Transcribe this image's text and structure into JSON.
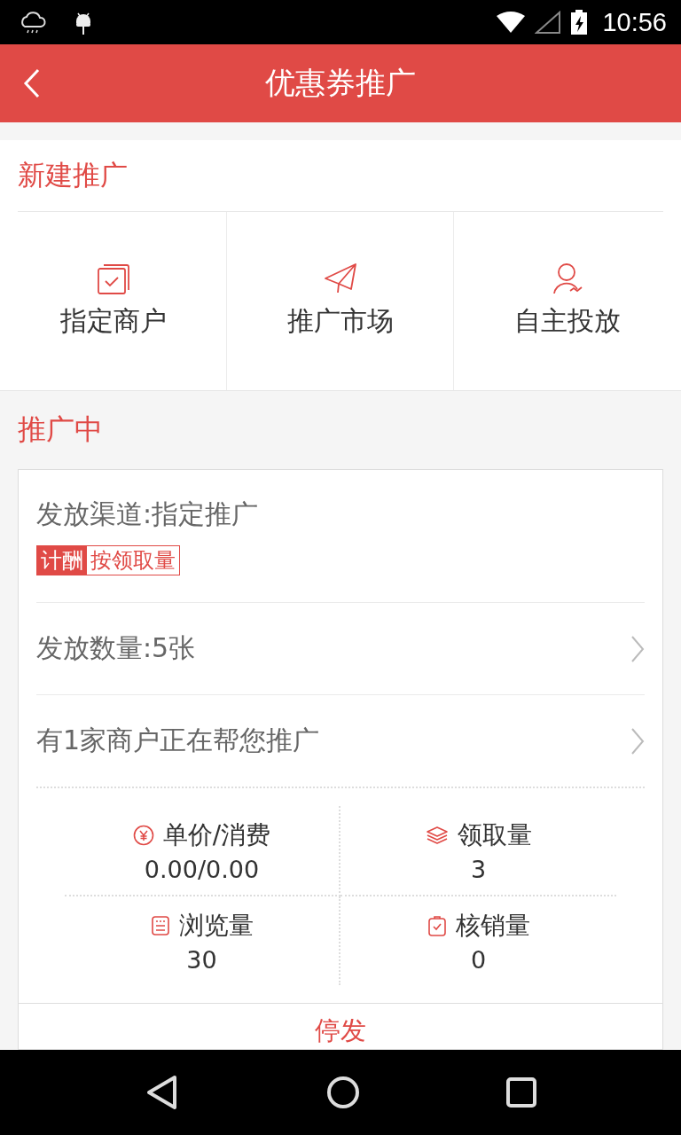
{
  "status_bar": {
    "time": "10:56"
  },
  "header": {
    "title": "优惠券推广"
  },
  "new_promotion": {
    "title": "新建推广",
    "options": [
      {
        "label": "指定商户"
      },
      {
        "label": "推广市场"
      },
      {
        "label": "自主投放"
      }
    ]
  },
  "active": {
    "title": "推广中",
    "card": {
      "channel": "发放渠道:指定推广",
      "tag": {
        "label": "计酬",
        "value": "按领取量"
      },
      "rows": [
        {
          "text": "发放数量:5张"
        },
        {
          "text": "有1家商户正在帮您推广"
        }
      ],
      "stats": [
        {
          "label": "单价/消费",
          "value": "0.00/0.00"
        },
        {
          "label": "领取量",
          "value": "3"
        },
        {
          "label": "浏览量",
          "value": "30"
        },
        {
          "label": "核销量",
          "value": "0"
        }
      ],
      "action": "停发"
    }
  }
}
